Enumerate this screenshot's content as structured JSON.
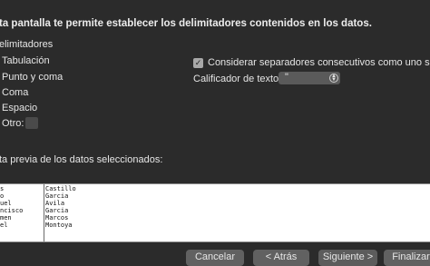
{
  "intro": "ta pantalla te permite establecer los delimitadores contenidos en los datos.",
  "delimiters": {
    "title": "elimitadores",
    "items": [
      {
        "label": "Tabulación"
      },
      {
        "label": "Punto y coma"
      },
      {
        "label": "Coma"
      },
      {
        "label": "Espacio"
      },
      {
        "label": "Otro:"
      }
    ]
  },
  "options": {
    "consecutive_label": "Considerar separadores consecutivos como uno solo",
    "consecutive_checked": true,
    "check_glyph": "✓",
    "qualifier_label": "Calificador de texto:",
    "qualifier_value": "\"",
    "stepper_icon": "up-down-chevron-icon"
  },
  "preview": {
    "label": "ta previa de los datos seleccionados:",
    "columns": [
      [
        "s",
        "o",
        "uel",
        "ncisco",
        "men",
        "el"
      ],
      [
        "Castillo",
        "Garcia",
        "Avila",
        "Garcia",
        "Marcos",
        "Montoya"
      ]
    ]
  },
  "buttons": {
    "cancel": "Cancelar",
    "back": "< Atrás",
    "next": "Siguiente >",
    "finish": "Finalizar"
  }
}
